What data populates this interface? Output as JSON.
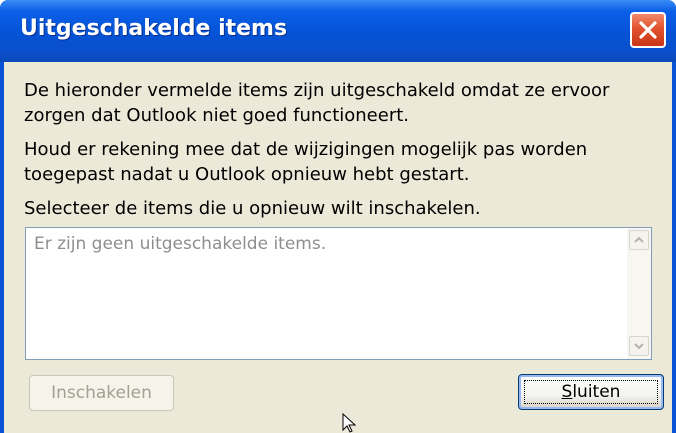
{
  "window": {
    "title": "Uitgeschakelde items"
  },
  "message": {
    "line1": "De hieronder vermelde items zijn uitgeschakeld omdat ze ervoor zorgen dat Outlook niet goed functioneert.",
    "line2": "Houd er rekening mee dat de wijzigingen mogelijk pas worden toegepast nadat u Outlook opnieuw hebt gestart.",
    "line3": "Selecteer de items die u opnieuw wilt inschakelen."
  },
  "list": {
    "empty_text": "Er zijn geen uitgeschakelde items."
  },
  "buttons": {
    "enable_label": "Inschakelen",
    "close_label_accel": "S",
    "close_label_rest": "luiten"
  },
  "colors": {
    "titlebar": "#0553d6",
    "client": "#ece9d8",
    "close_button": "#e2532e"
  },
  "icons": [
    "close-icon",
    "scroll-up-icon",
    "scroll-down-icon",
    "mouse-cursor-icon"
  ]
}
